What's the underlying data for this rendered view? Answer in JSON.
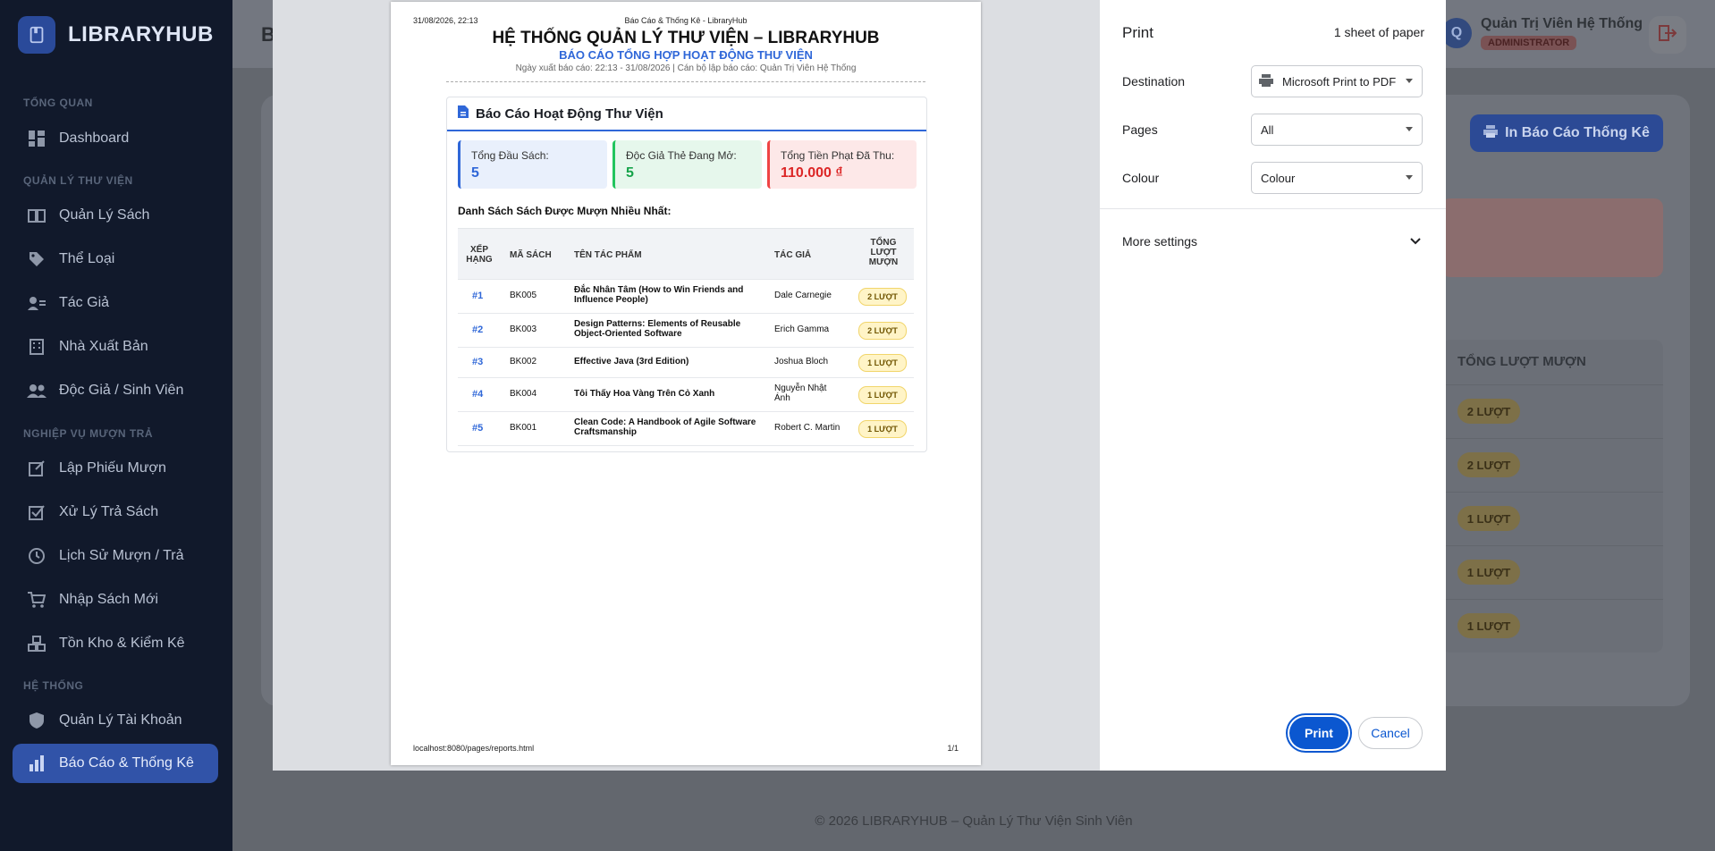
{
  "app": {
    "logo": "LIBRARYHUB",
    "page_letter": "B",
    "sections": {
      "overview": "TỔNG QUAN",
      "books": "QUẢN LÝ THƯ VIỆN",
      "ops": "NGHIỆP VỤ MƯỢN TRẢ",
      "system": "HỆ THỐNG"
    },
    "nav": [
      {
        "label": "Dashboard",
        "icon": "dashboard-icon"
      },
      {
        "label": "Quản Lý Sách",
        "icon": "book-icon"
      },
      {
        "label": "Thể Loại",
        "icon": "tag-icon"
      },
      {
        "label": "Tác Giả",
        "icon": "author-icon"
      },
      {
        "label": "Nhà Xuất Bản",
        "icon": "building-icon"
      },
      {
        "label": "Độc Giả / Sinh Viên",
        "icon": "users-icon"
      },
      {
        "label": "Lập Phiếu Mượn",
        "icon": "edit-icon"
      },
      {
        "label": "Xử Lý Trả Sách",
        "icon": "check-square-icon"
      },
      {
        "label": "Lịch Sử Mượn / Trả",
        "icon": "clock-icon"
      },
      {
        "label": "Nhập Sách Mới",
        "icon": "cart-icon"
      },
      {
        "label": "Tồn Kho & Kiểm Kê",
        "icon": "boxes-icon"
      },
      {
        "label": "Quản Lý Tài Khoản",
        "icon": "shield-icon"
      },
      {
        "label": "Báo Cáo & Thống Kê",
        "icon": "chart-icon"
      }
    ],
    "user": {
      "initial": "Q",
      "name": "Quản Trị Viên Hệ Thống",
      "role": "ADMINISTRATOR"
    },
    "print_report_button": "In Báo Cáo Thống Kê",
    "table_header": "TỔNG LƯỢT MƯỢN",
    "badges": [
      "2 LƯỢT",
      "2 LƯỢT",
      "1 LƯỢT",
      "1 LƯỢT",
      "1 LƯỢT"
    ],
    "footer": "© 2026 LIBRARYHUB – Quản Lý Thư Viện Sinh Viên"
  },
  "preview": {
    "print_datetime": "31/08/2026, 22:13",
    "doc_title": "Báo Cáo & Thống Kê - LibraryHub",
    "title": "HỆ THỐNG QUẢN LÝ THƯ VIỆN – LIBRARYHUB",
    "subtitle": "BÁO CÁO TỔNG HỢP HOẠT ĐỘNG THƯ VIỆN",
    "meta": "Ngày xuất báo cáo: 22:13 - 31/08/2026 | Cán bộ lập báo cáo: Quản Trị Viên Hệ Thống",
    "panel_title": "Báo Cáo Hoạt Động Thư Viện",
    "stats": [
      {
        "label": "Tổng Đầu Sách:",
        "value": "5",
        "color": "#2f67d8",
        "bg": "#e9f0fc",
        "border": "#2f67d8"
      },
      {
        "label": "Độc Giả Thẻ Đang Mở:",
        "value": "5",
        "color": "#16a34a",
        "bg": "#e6f7ec",
        "border": "#22c55e"
      },
      {
        "label": "Tổng Tiền Phạt Đã Thu:",
        "value": "110.000 ₫",
        "color": "#dc2626",
        "bg": "#fde8e8",
        "border": "#ef4444"
      }
    ],
    "list_title": "Danh Sách Sách Được Mượn Nhiều Nhất:",
    "columns": [
      "XẾP HẠNG",
      "MÃ SÁCH",
      "TÊN TÁC PHẨM",
      "TÁC GIẢ",
      "TỔNG LƯỢT MƯỢN"
    ],
    "rows": [
      {
        "rank": "#1",
        "code": "BK005",
        "title": "Đắc Nhân Tâm (How to Win Friends and Influence People)",
        "author": "Dale Carnegie",
        "count": "2 LƯỢT"
      },
      {
        "rank": "#2",
        "code": "BK003",
        "title": "Design Patterns: Elements of Reusable Object-Oriented Software",
        "author": "Erich Gamma",
        "count": "2 LƯỢT"
      },
      {
        "rank": "#3",
        "code": "BK002",
        "title": "Effective Java (3rd Edition)",
        "author": "Joshua Bloch",
        "count": "1 LƯỢT"
      },
      {
        "rank": "#4",
        "code": "BK004",
        "title": "Tôi Thấy Hoa Vàng Trên Cỏ Xanh",
        "author": "Nguyễn Nhật Ánh",
        "count": "1 LƯỢT"
      },
      {
        "rank": "#5",
        "code": "BK001",
        "title": "Clean Code: A Handbook of Agile Software Craftsmanship",
        "author": "Robert C. Martin",
        "count": "1 LƯỢT"
      }
    ],
    "url": "localhost:8080/pages/reports.html",
    "page": "1/1"
  },
  "print": {
    "title": "Print",
    "sheets": "1 sheet of paper",
    "destination_label": "Destination",
    "destination_value": "Microsoft Print to PDF",
    "pages_label": "Pages",
    "pages_value": "All",
    "colour_label": "Colour",
    "colour_value": "Colour",
    "more_settings": "More settings",
    "print_button": "Print",
    "cancel_button": "Cancel"
  }
}
